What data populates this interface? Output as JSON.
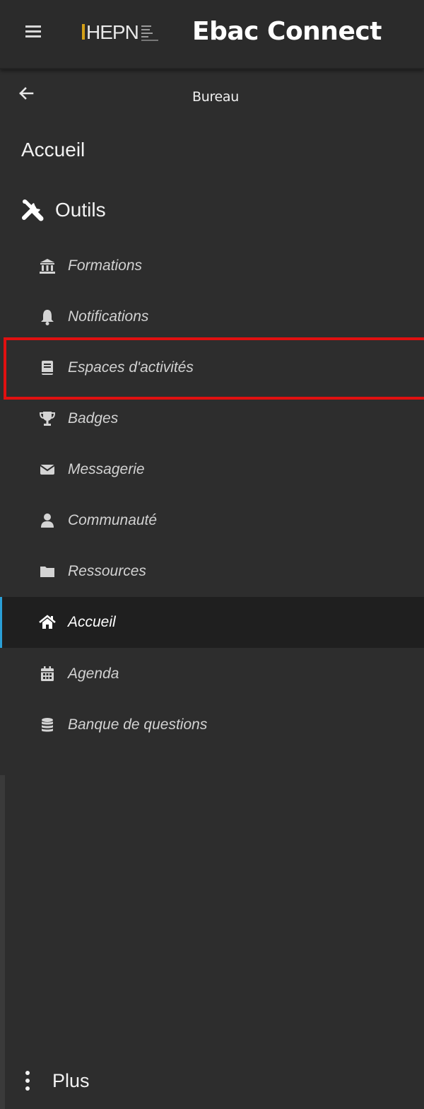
{
  "header": {
    "logo_text": "HEPN",
    "app_title": "Ebac Connect",
    "menu_icon": "hamburger-menu-icon"
  },
  "nav": {
    "back_icon": "arrow-left-icon",
    "back_label": "Bureau",
    "home_label": "Accueil",
    "tools_label": "Outils",
    "tools_icon": "tools-icon"
  },
  "menu": {
    "items": [
      {
        "label": "Formations",
        "icon": "university-icon"
      },
      {
        "label": "Notifications",
        "icon": "bell-icon"
      },
      {
        "label": "Espaces d'activités",
        "icon": "book-icon",
        "highlighted": true
      },
      {
        "label": "Badges",
        "icon": "trophy-icon"
      },
      {
        "label": "Messagerie",
        "icon": "envelope-icon"
      },
      {
        "label": "Communauté",
        "icon": "user-icon"
      },
      {
        "label": "Ressources",
        "icon": "folder-icon"
      },
      {
        "label": "Accueil",
        "icon": "home-icon",
        "active": true
      },
      {
        "label": "Agenda",
        "icon": "calendar-icon"
      },
      {
        "label": "Banque de questions",
        "icon": "database-icon"
      }
    ]
  },
  "footer": {
    "more_label": "Plus",
    "more_icon": "vertical-dots-icon"
  },
  "colors": {
    "background": "#2d2d2d",
    "active_background": "#1f1f1f",
    "active_accent": "#2a9fd6",
    "highlight_border": "#e01010",
    "logo_accent": "#d4a017"
  }
}
